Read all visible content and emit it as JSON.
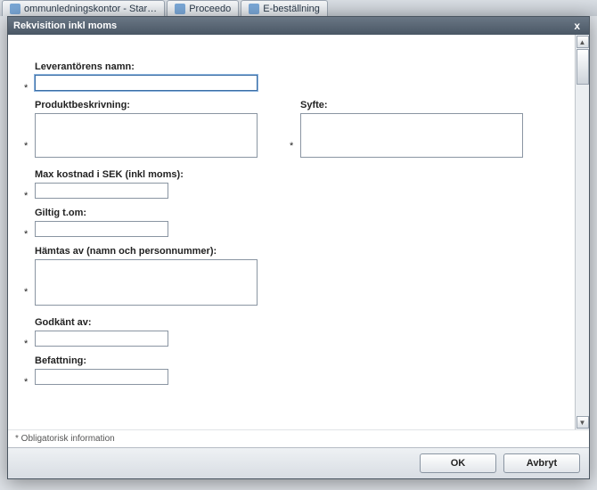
{
  "background": {
    "tabs": [
      {
        "label": "ommunledningskontor - Star…"
      },
      {
        "label": "Proceedo"
      },
      {
        "label": "E-beställning"
      }
    ]
  },
  "modal": {
    "title": "Rekvisition inkl moms",
    "close_label": "x",
    "fields": {
      "leverantor": {
        "label": "Leverantörens namn:",
        "value": ""
      },
      "produktbeskrivning": {
        "label": "Produktbeskrivning:",
        "value": ""
      },
      "syfte": {
        "label": "Syfte:",
        "value": ""
      },
      "maxkostnad": {
        "label": "Max kostnad i SEK (inkl moms):",
        "value": ""
      },
      "giltig": {
        "label": "Giltig t.om:",
        "value": ""
      },
      "hamtas": {
        "label": "Hämtas av (namn och personnummer):",
        "value": ""
      },
      "godkant": {
        "label": "Godkänt av:",
        "value": ""
      },
      "befattning": {
        "label": "Befattning:",
        "value": ""
      }
    },
    "required_marker": "*",
    "footer_note": "* Obligatorisk information",
    "buttons": {
      "ok": "OK",
      "cancel": "Avbryt"
    }
  }
}
